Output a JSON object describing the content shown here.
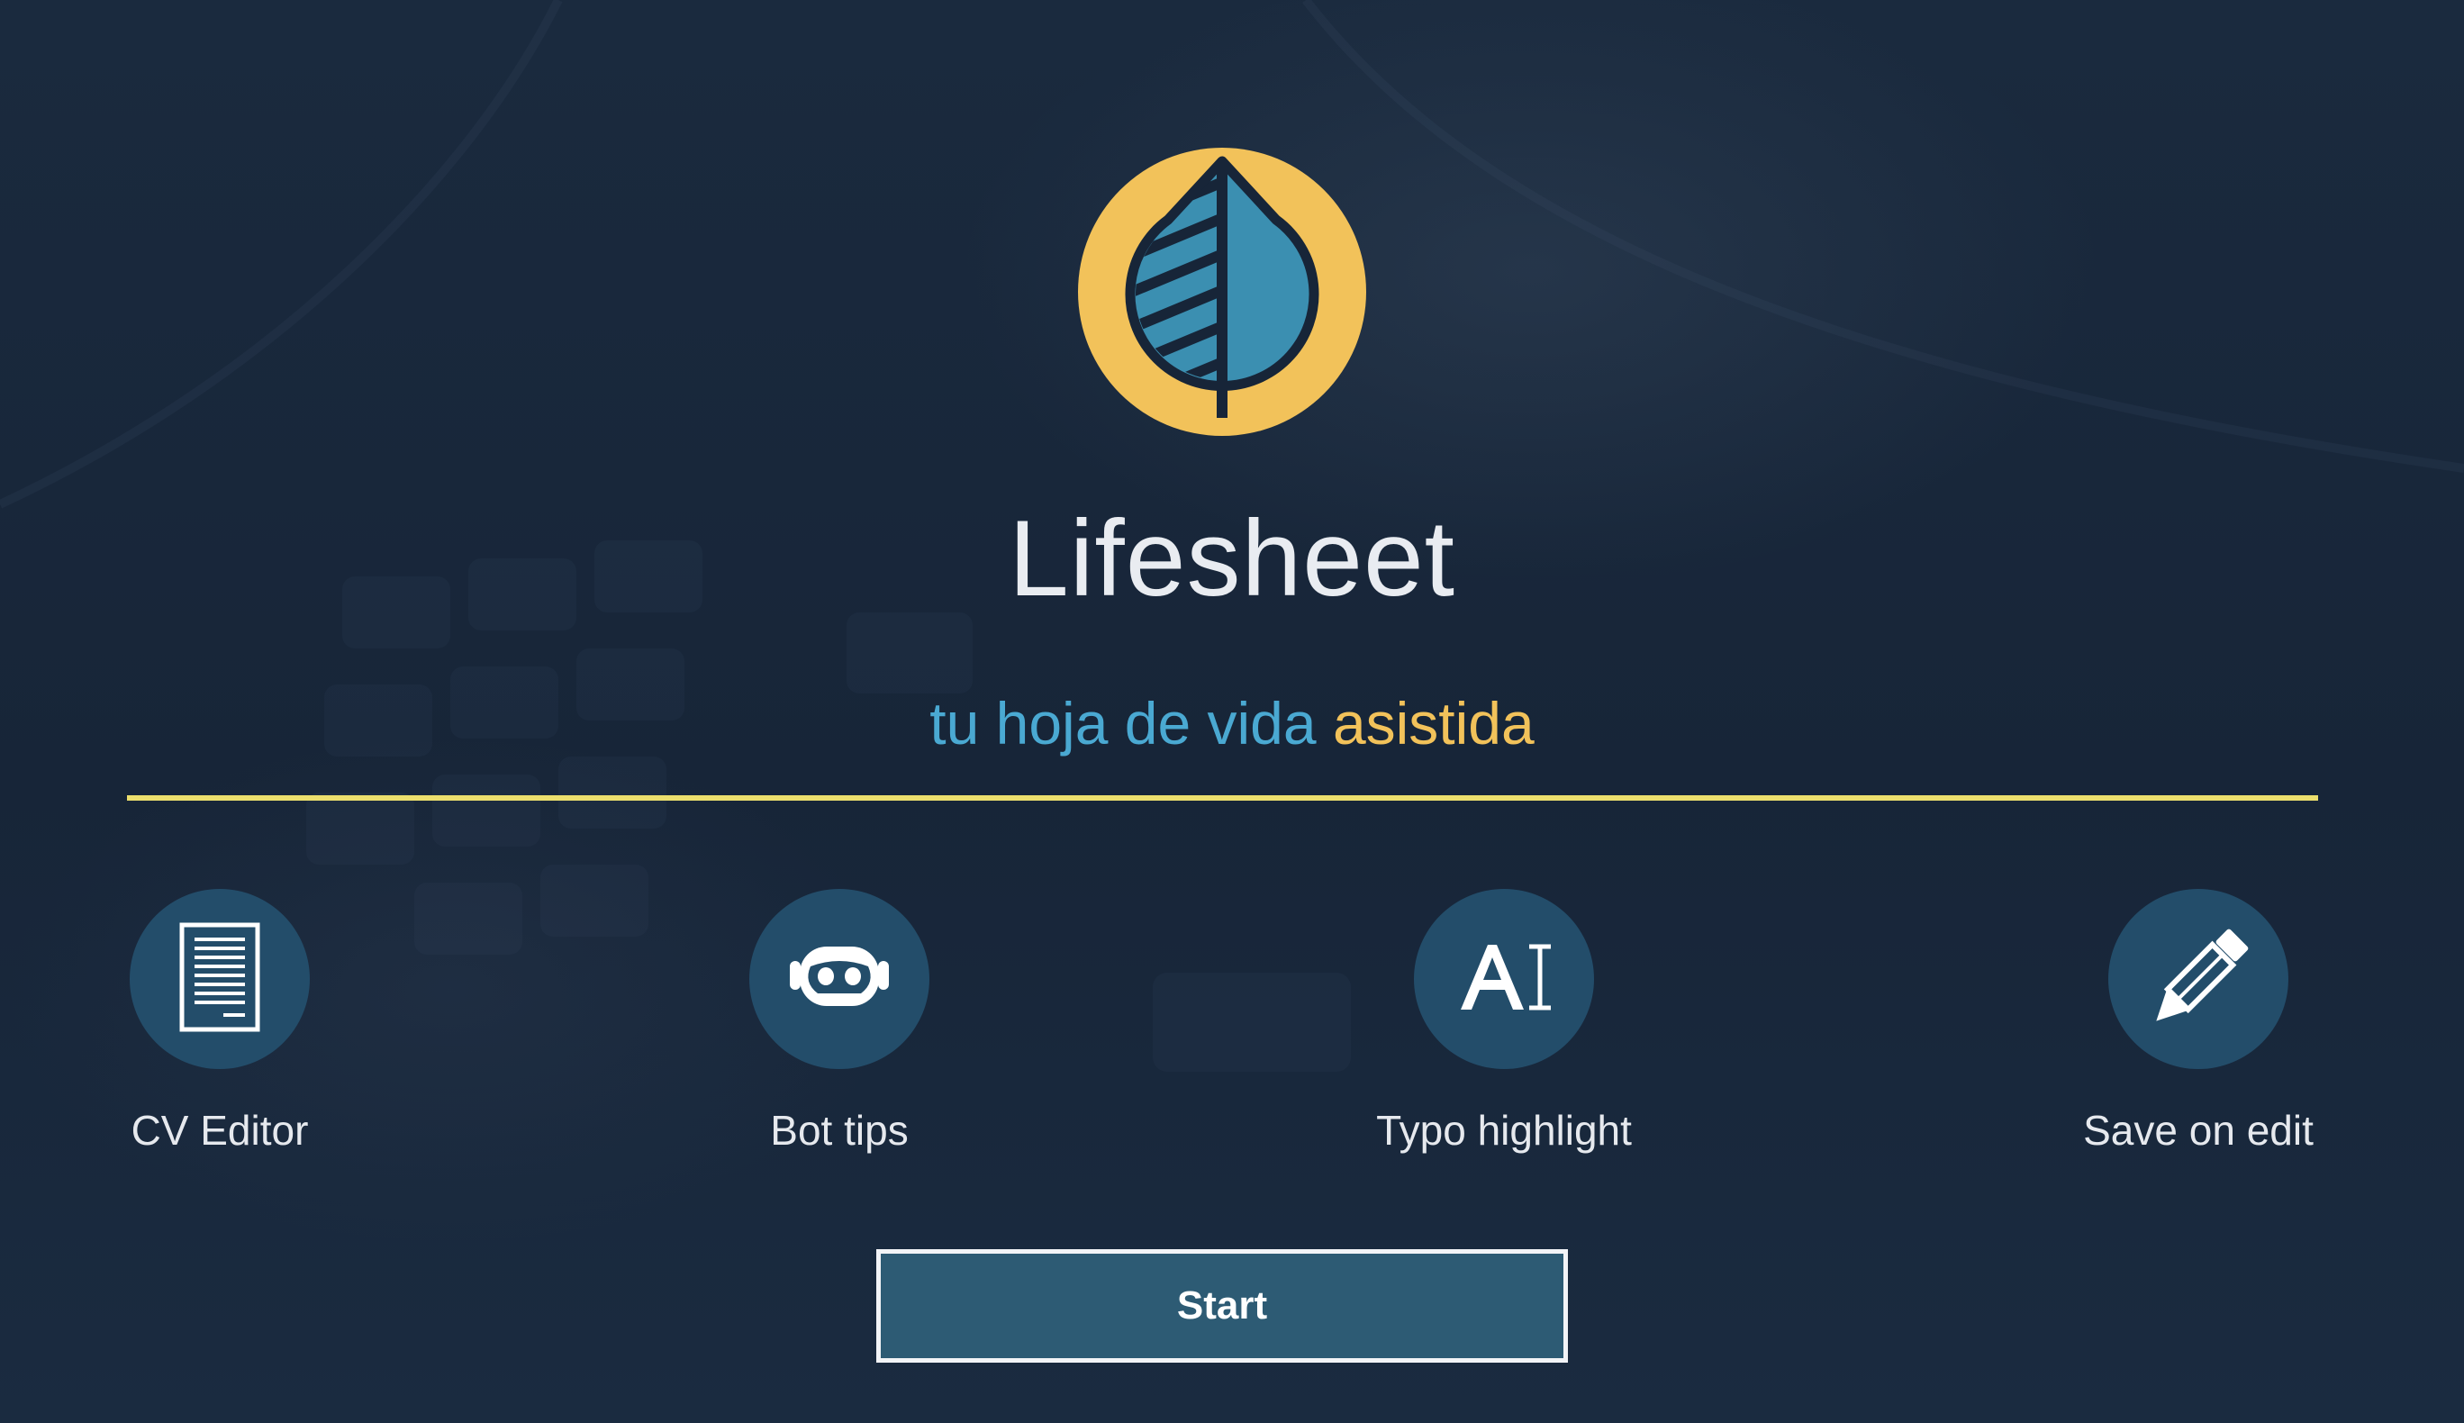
{
  "app": {
    "title": "Lifesheet",
    "tagline_part1": "tu hoja de vida",
    "tagline_part2": "asistida"
  },
  "colors": {
    "background": "#172538",
    "logo_circle": "#f2c25a",
    "leaf": "#3b8fb1",
    "tagline_blue": "#4aa9d2",
    "tagline_yellow": "#f2c25a",
    "divider": "#ecdf6d",
    "feature_circle": "#234d6a",
    "button_fill": "#2d5b74",
    "button_border": "#f2f4f7"
  },
  "features": [
    {
      "label": "CV Editor",
      "icon": "document-icon"
    },
    {
      "label": "Bot tips",
      "icon": "robot-icon"
    },
    {
      "label": "Typo highlight",
      "icon": "text-cursor-icon"
    },
    {
      "label": "Save on edit",
      "icon": "pencil-icon"
    }
  ],
  "start_button": {
    "label": "Start"
  }
}
